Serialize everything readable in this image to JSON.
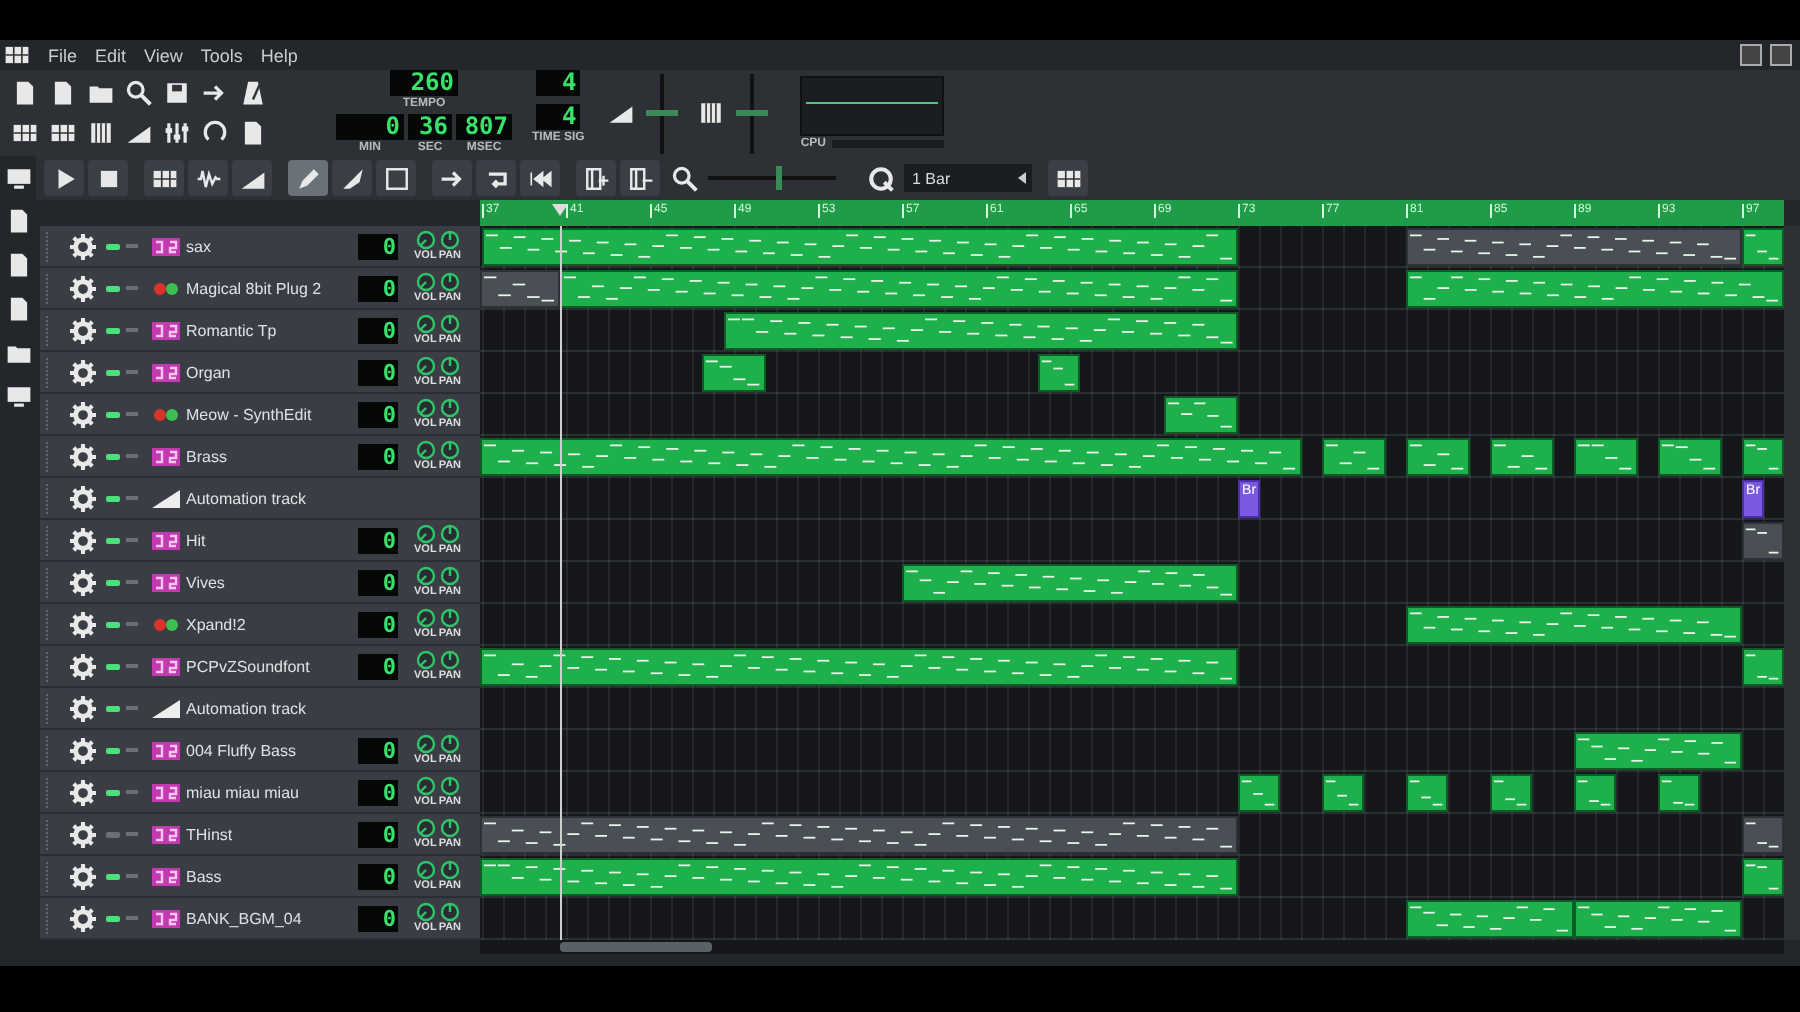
{
  "menu": [
    "File",
    "Edit",
    "View",
    "Tools",
    "Help"
  ],
  "transport": {
    "tempo": "260",
    "tempo_label": "TEMPO",
    "min": "0",
    "min_label": "MIN",
    "sec": "36",
    "sec_label": "SEC",
    "msec": "807",
    "msec_label": "MSEC",
    "time_sig_numerator": "4",
    "time_sig_denominator": "4",
    "time_sig_label": "TIME SIG",
    "cpu_label": "CPU"
  },
  "master_volume": {
    "level": 0.5
  },
  "master_pitch": {
    "level": 0.5
  },
  "song_editor": {
    "tools": [
      {
        "kind": "draw",
        "selected": true
      },
      {
        "kind": "knife",
        "selected": false
      },
      {
        "kind": "select",
        "selected": false
      }
    ],
    "zoom": {
      "level": 0.55
    },
    "quantize": "1 Bar"
  },
  "ruler": [
    "37",
    "41",
    "45",
    "49",
    "53",
    "57",
    "61",
    "65",
    "69",
    "73",
    "77",
    "81",
    "85",
    "89",
    "93",
    "97"
  ],
  "tracks": [
    {
      "kind": "instrument",
      "name": "sax",
      "muted": false,
      "value": "0",
      "volume_label": "VOL",
      "pan_label": "PAN",
      "clips": [
        {
          "muted": false
        },
        {
          "muted": true
        },
        {
          "muted": false
        }
      ]
    },
    {
      "kind": "plugin",
      "name": "Magical 8bit Plug 2",
      "muted": false,
      "value": "0",
      "volume_label": "VOL",
      "pan_label": "PAN",
      "clips": [
        {
          "muted": true
        },
        {
          "muted": false
        },
        {
          "muted": false
        }
      ]
    },
    {
      "kind": "instrument",
      "name": "Romantic Tp",
      "muted": false,
      "value": "0",
      "volume_label": "VOL",
      "pan_label": "PAN",
      "clips": [
        {
          "muted": false
        }
      ]
    },
    {
      "kind": "instrument",
      "name": "Organ",
      "muted": false,
      "value": "0",
      "volume_label": "VOL",
      "pan_label": "PAN",
      "clips": [
        {
          "muted": false
        },
        {
          "muted": false
        }
      ]
    },
    {
      "kind": "plugin",
      "name": "Meow - SynthEdit",
      "muted": false,
      "value": "0",
      "volume_label": "VOL",
      "pan_label": "PAN",
      "clips": [
        {
          "muted": false
        }
      ]
    },
    {
      "kind": "instrument",
      "name": "Brass",
      "muted": false,
      "value": "0",
      "volume_label": "VOL",
      "pan_label": "PAN",
      "clips": [
        {
          "muted": false
        },
        {
          "muted": false
        },
        {
          "muted": false
        },
        {
          "muted": false
        },
        {
          "muted": false
        },
        {
          "muted": false
        },
        {
          "muted": false
        }
      ]
    },
    {
      "kind": "automation",
      "name": "Automation track",
      "muted": false,
      "clips": [
        {
          "label": "Br"
        },
        {
          "label": "Br"
        }
      ]
    },
    {
      "kind": "instrument",
      "name": "Hit",
      "muted": false,
      "value": "0",
      "volume_label": "VOL",
      "pan_label": "PAN",
      "clips": [
        {
          "muted": true
        }
      ]
    },
    {
      "kind": "instrument",
      "name": "Vives",
      "muted": false,
      "value": "0",
      "volume_label": "VOL",
      "pan_label": "PAN",
      "clips": [
        {
          "muted": false
        }
      ]
    },
    {
      "kind": "plugin",
      "name": "Xpand!2",
      "muted": false,
      "value": "0",
      "volume_label": "VOL",
      "pan_label": "PAN",
      "clips": [
        {
          "muted": false
        }
      ]
    },
    {
      "kind": "instrument",
      "name": "PCPvZSoundfont",
      "muted": false,
      "value": "0",
      "volume_label": "VOL",
      "pan_label": "PAN",
      "clips": [
        {
          "muted": false
        },
        {
          "muted": false
        }
      ]
    },
    {
      "kind": "automation",
      "name": "Automation track",
      "muted": false
    },
    {
      "kind": "instrument",
      "name": "004 Fluffy Bass",
      "muted": false,
      "value": "0",
      "volume_label": "VOL",
      "pan_label": "PAN",
      "clips": [
        {
          "muted": false
        }
      ]
    },
    {
      "kind": "instrument",
      "name": "miau miau miau",
      "muted": false,
      "value": "0",
      "volume_label": "VOL",
      "pan_label": "PAN",
      "clips": [
        {
          "muted": false
        },
        {
          "muted": false
        },
        {
          "muted": false
        },
        {
          "muted": false
        },
        {
          "muted": false
        },
        {
          "muted": false
        }
      ]
    },
    {
      "kind": "instrument",
      "name": "THinst",
      "muted": true,
      "value": "0",
      "volume_label": "VOL",
      "pan_label": "PAN",
      "clips": [
        {
          "muted": true
        },
        {
          "muted": true
        }
      ]
    },
    {
      "kind": "instrument",
      "name": "Bass",
      "muted": false,
      "value": "0",
      "volume_label": "VOL",
      "pan_label": "PAN",
      "clips": [
        {
          "muted": false
        },
        {
          "muted": false
        }
      ]
    },
    {
      "kind": "instrument",
      "name": "BANK_BGM_04",
      "muted": false,
      "value": "0",
      "volume_label": "VOL",
      "pan_label": "PAN",
      "clips": [
        {
          "muted": false
        },
        {
          "muted": false
        }
      ]
    }
  ]
}
